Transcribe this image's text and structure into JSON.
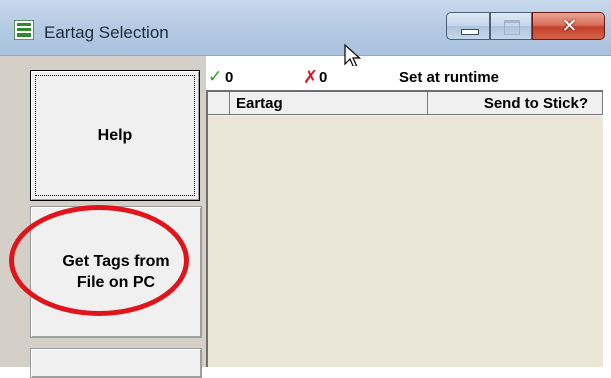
{
  "window": {
    "title": "Eartag Selection",
    "icon": "eartag-app-icon",
    "controls": {
      "minimize": "minimize-icon",
      "maximize": "maximize-icon",
      "close": "close-icon"
    }
  },
  "sidebar": {
    "help_label": "Help",
    "get_tags_label": "Get Tags from\nFile on PC",
    "third_label": ""
  },
  "status": {
    "ok_icon": "check-icon",
    "ok_count": "0",
    "error_icon": "cross-icon",
    "error_count": "0",
    "runtime_text": "Set at runtime"
  },
  "table": {
    "columns": [
      "Eartag",
      "Send to Stick?"
    ],
    "rows": []
  },
  "colors": {
    "highlight_ellipse": "#e1141c",
    "check": "#2e9b1c",
    "cross": "#e0141c",
    "grid_background": "#ebe7d8"
  }
}
